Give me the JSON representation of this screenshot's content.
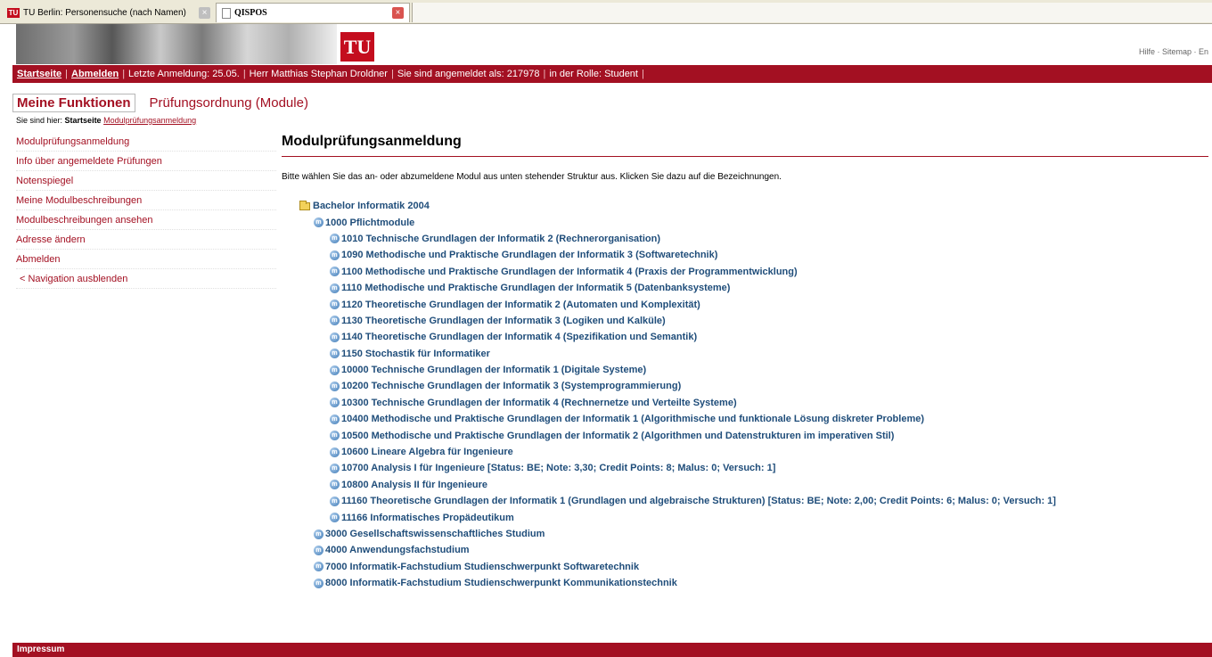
{
  "browser": {
    "tabs": [
      {
        "title": "TU Berlin: Personensuche (nach Namen)",
        "icon": "tu-logo-icon"
      },
      {
        "title": "QISPOS",
        "icon": "document-icon"
      }
    ]
  },
  "header": {
    "logo_text": "TU",
    "util_links": "Hilfe · Sitemap · En"
  },
  "statusbar": {
    "home": "Startseite",
    "logout": "Abmelden",
    "last_login": "Letzte Anmeldung:  25.05.",
    "user": "Herr Matthias Stephan Droldner",
    "logged_in_as": "Sie sind angemeldet als: 217978",
    "role": "in der Rolle: Student"
  },
  "topnav": {
    "active": "Meine Funktionen",
    "other": "Prüfungsordnung (Module)"
  },
  "breadcrumb": {
    "prefix": "Sie sind hier:",
    "home": "Startseite",
    "current": "Modulprüfungsanmeldung"
  },
  "sidebar": {
    "items": [
      "Modulprüfungsanmeldung",
      "Info über angemeldete Prüfungen",
      "Notenspiegel",
      "Meine Modulbeschreibungen",
      "Modulbeschreibungen ansehen",
      "Adresse ändern",
      "Abmelden"
    ],
    "hide_nav": "<  Navigation ausblenden"
  },
  "main": {
    "title": "Modulprüfungsanmeldung",
    "intro": "Bitte wählen Sie das an- oder abzumeldene Modul aus unten stehender Struktur aus. Klicken Sie dazu auf die Bezeichnungen."
  },
  "tree": {
    "root": "Bachelor Informatik 2004",
    "pflicht": "1000 Pflichtmodule",
    "pflicht_modules": [
      "1010 Technische Grundlagen der Informatik 2 (Rechnerorganisation)",
      "1090 Methodische und Praktische Grundlagen der Informatik 3 (Softwaretechnik)",
      "1100 Methodische und Praktische Grundlagen der Informatik 4 (Praxis der Programmentwicklung)",
      "1110 Methodische und Praktische Grundlagen der Informatik 5 (Datenbanksysteme)",
      "1120 Theoretische Grundlagen der Informatik 2 (Automaten und Komplexität)",
      "1130 Theoretische Grundlagen der Informatik 3 (Logiken und Kalküle)",
      "1140 Theoretische Grundlagen der Informatik 4 (Spezifikation und Semantik)",
      "1150 Stochastik für Informatiker",
      "10000 Technische Grundlagen der Informatik 1 (Digitale Systeme)",
      "10200 Technische Grundlagen der Informatik 3 (Systemprogrammierung)",
      "10300 Technische Grundlagen der Informatik 4 (Rechnernetze und Verteilte Systeme)",
      "10400 Methodische und Praktische Grundlagen der Informatik 1 (Algorithmische und funktionale Lösung diskreter Probleme)",
      "10500 Methodische und Praktische Grundlagen der Informatik 2 (Algorithmen und Datenstrukturen im imperativen Stil)",
      "10600 Lineare Algebra für Ingenieure",
      "10700 Analysis I für Ingenieure [Status: BE; Note: 3,30; Credit Points: 8; Malus: 0; Versuch: 1]",
      "10800 Analysis II für Ingenieure",
      "11160 Theoretische Grundlagen der Informatik 1 (Grundlagen und algebraische Strukturen) [Status: BE; Note: 2,00; Credit Points: 6; Malus: 0; Versuch: 1]",
      "11166 Informatisches Propädeutikum"
    ],
    "other_groups": [
      "3000 Gesellschaftswissenschaftliches Studium",
      "4000 Anwendungsfachstudium",
      "7000 Informatik-Fachstudium Studienschwerpunkt Softwaretechnik",
      "8000 Informatik-Fachstudium Studienschwerpunkt Kommunikationstechnik"
    ]
  },
  "footer": {
    "impressum": "Impressum"
  }
}
